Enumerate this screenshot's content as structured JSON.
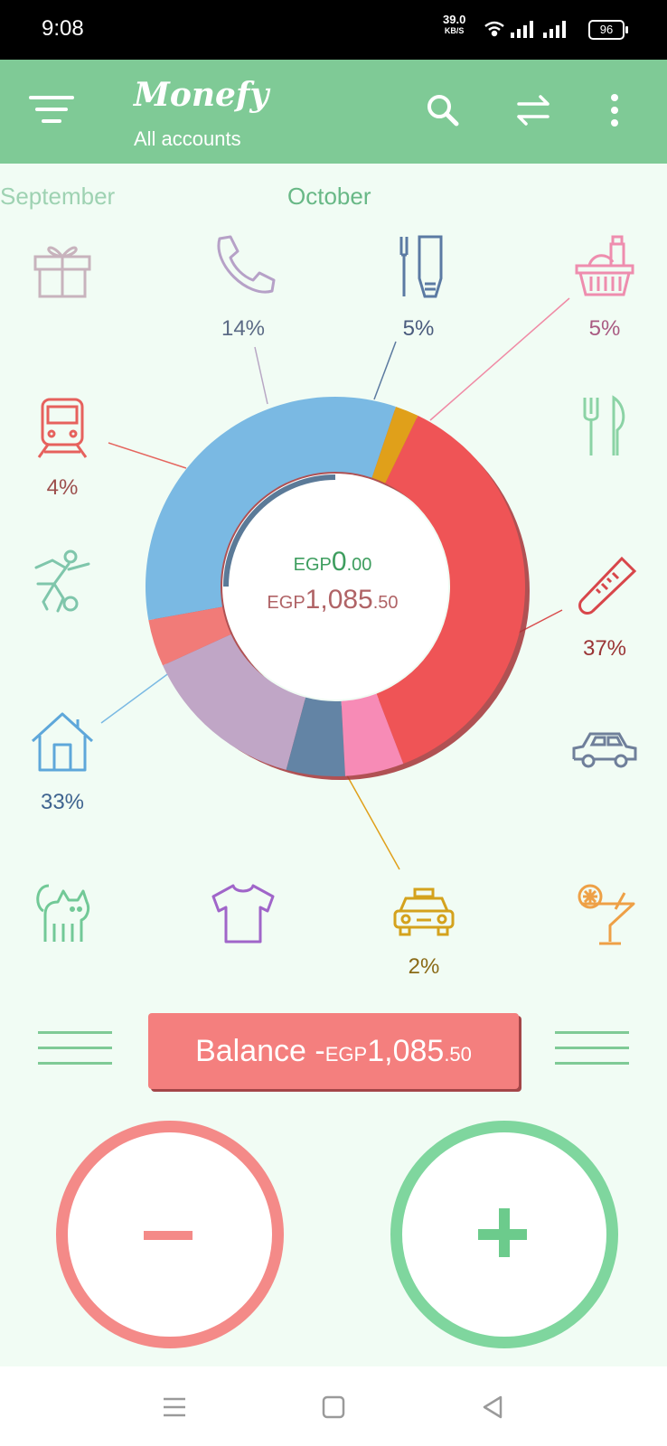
{
  "status_bar": {
    "time": "9:08",
    "speed_value": "39.0",
    "speed_unit": "KB/S",
    "battery": "96"
  },
  "app_bar": {
    "menu_icon": "filter-menu-icon",
    "title": "Monefy",
    "subtitle": "All accounts",
    "search_icon": "search-icon",
    "transfer_icon": "transfer-icon",
    "more_icon": "more-vertical-icon"
  },
  "months": {
    "previous": "September",
    "current": "October"
  },
  "categories": [
    {
      "name": "gifts",
      "icon": "gift-icon",
      "percent": ""
    },
    {
      "name": "communications",
      "icon": "phone-icon",
      "percent": "14%"
    },
    {
      "name": "toiletry",
      "icon": "toiletry-icon",
      "percent": "5%"
    },
    {
      "name": "food",
      "icon": "basket-icon",
      "percent": "5%"
    },
    {
      "name": "transport",
      "icon": "train-icon",
      "percent": "4%"
    },
    {
      "name": "eating-out",
      "icon": "fork-knife-icon",
      "percent": ""
    },
    {
      "name": "sports",
      "icon": "soccer-player-icon",
      "percent": ""
    },
    {
      "name": "health",
      "icon": "thermometer-icon",
      "percent": "37%"
    },
    {
      "name": "house",
      "icon": "house-icon",
      "percent": "33%"
    },
    {
      "name": "car",
      "icon": "car-icon",
      "percent": ""
    },
    {
      "name": "pets",
      "icon": "cat-icon",
      "percent": ""
    },
    {
      "name": "clothes",
      "icon": "tshirt-icon",
      "percent": ""
    },
    {
      "name": "taxi",
      "icon": "taxi-icon",
      "percent": "2%"
    },
    {
      "name": "entertainment",
      "icon": "cocktail-icon",
      "percent": ""
    }
  ],
  "chart_data": {
    "type": "pie",
    "categories": [
      "Health",
      "Taxi",
      "House",
      "Transport",
      "Communications",
      "Toiletry",
      "Food"
    ],
    "values": [
      37,
      2,
      33,
      4,
      14,
      5,
      5
    ],
    "colors": [
      "#ef5456",
      "#e0a01a",
      "#7ab9e3",
      "#f17b78",
      "#c0a6c6",
      "#6384a5",
      "#f78bb6"
    ]
  },
  "summary": {
    "income_currency": "EGP",
    "income_int": "0",
    "income_dec": ".00",
    "expense_currency": "EGP",
    "expense_int": "1,085",
    "expense_dec": ".50"
  },
  "balance": {
    "label": "Balance",
    "sign": "-",
    "currency": "EGP",
    "amount_int": "1,085",
    "amount_dec": ".50"
  },
  "buttons": {
    "expense": "minus-icon",
    "income": "plus-icon"
  },
  "colors": {
    "header": "#7fca96",
    "background": "#f1fcf4",
    "expense": "#f48a88",
    "income": "#7fd69e",
    "balance_bg": "#f47f7e"
  }
}
